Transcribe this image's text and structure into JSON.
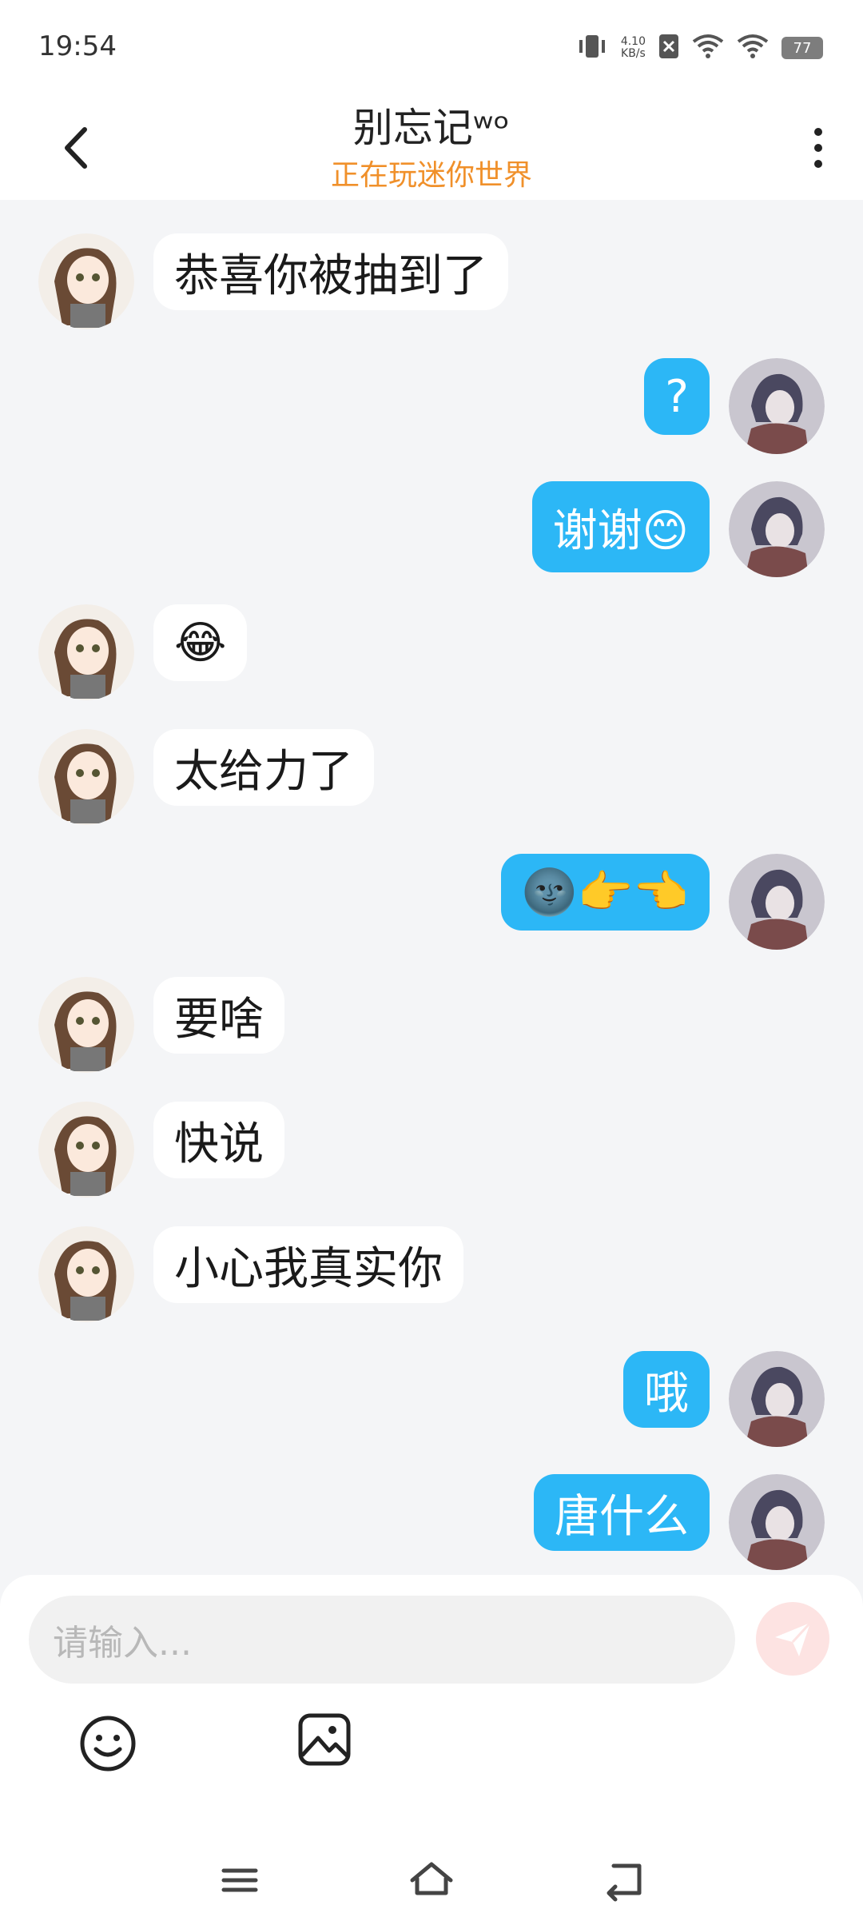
{
  "status_bar": {
    "time": "19:54",
    "net_speed_value": "4.10",
    "net_speed_unit": "KB/s",
    "battery": "77"
  },
  "header": {
    "title": "别忘记ʷᵒ",
    "subtitle": "正在玩迷你世界"
  },
  "messages": [
    {
      "side": "left",
      "text": "恭喜你被抽到了"
    },
    {
      "side": "right",
      "text": "?"
    },
    {
      "side": "right",
      "text": "谢谢😊"
    },
    {
      "side": "left",
      "text": "😂"
    },
    {
      "side": "left",
      "text": "太给力了"
    },
    {
      "side": "right",
      "text": "🌚👉👈"
    },
    {
      "side": "left",
      "text": "要啥"
    },
    {
      "side": "left",
      "text": "快说"
    },
    {
      "side": "left",
      "text": "小心我真实你"
    },
    {
      "side": "right",
      "text": "哦"
    },
    {
      "side": "right",
      "text": "唐什么"
    }
  ],
  "composer": {
    "placeholder": "请输入..."
  },
  "colors": {
    "accent": "#2cb7f6",
    "subtitle": "#f0902a",
    "background": "#f4f5f7",
    "send_button": "#fde3e2"
  },
  "icons": [
    "back-icon",
    "more-icon",
    "vibrate-icon",
    "sim-icon",
    "wifi-icon",
    "emoji-icon",
    "image-icon",
    "send-icon",
    "menu-icon",
    "home-icon",
    "back-nav-icon"
  ]
}
